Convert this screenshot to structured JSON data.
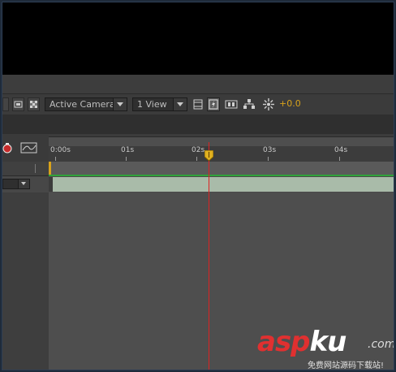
{
  "toolbar": {
    "camera_dropdown": "Active Camera",
    "view_dropdown": "1 View",
    "exposure_value": "+0.0",
    "icons": [
      "region-icon",
      "transparency-grid-icon",
      "toggle-pixel-icon",
      "fast-previews-icon",
      "timeline-icon",
      "flowchart-icon",
      "exposure-icon"
    ]
  },
  "timeline": {
    "ruler_labels": [
      "0:00s",
      "01s",
      "02s",
      "03s",
      "04s"
    ],
    "current_time_indicator": "02s"
  },
  "watermark": {
    "main_left": "asp",
    "main_k": "ku",
    "suffix": ".com",
    "subtitle": "免费网站源码下载站!"
  },
  "colors": {
    "accent_yellow": "#d8a21b",
    "cti_red": "#dd2222",
    "layer_bar": "#a9bba9",
    "workarea_green": "#2fa33a"
  }
}
